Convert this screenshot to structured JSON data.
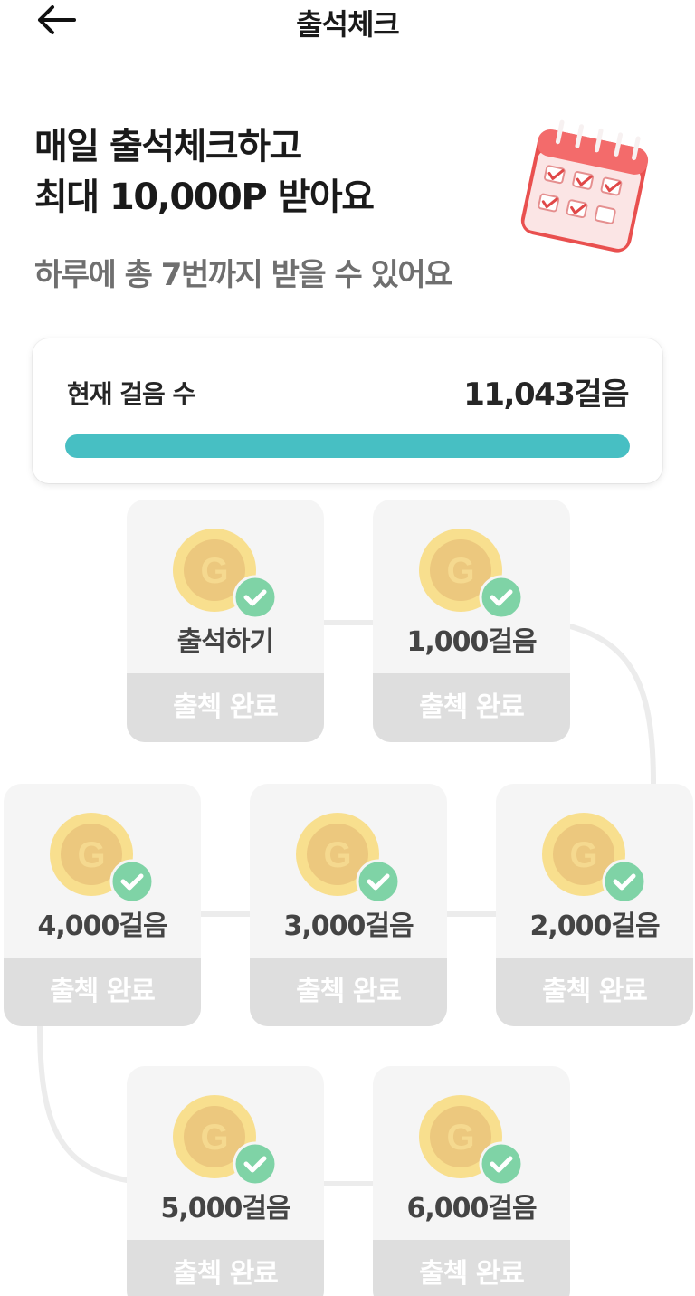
{
  "header": {
    "title": "출석체크"
  },
  "hero": {
    "title_line1": "매일 출석체크하고",
    "title_line2": "최대 10,000P 받아요",
    "subtitle": "하루에 총 7번까지 받을 수 있어요"
  },
  "steps": {
    "label": "현재 걸음 수",
    "value": "11,043걸음",
    "progress_fraction": 1.0
  },
  "rewards": [
    {
      "label": "출석하기",
      "status": "출첵 완료",
      "checked": true
    },
    {
      "label": "1,000걸음",
      "status": "출첵 완료",
      "checked": true
    },
    {
      "label": "2,000걸음",
      "status": "출첵 완료",
      "checked": true
    },
    {
      "label": "3,000걸음",
      "status": "출첵 완료",
      "checked": true
    },
    {
      "label": "4,000걸음",
      "status": "출첵 완료",
      "checked": true
    },
    {
      "label": "5,000걸음",
      "status": "출첵 완료",
      "checked": true
    },
    {
      "label": "6,000걸음",
      "status": "출첵 완료",
      "checked": true
    }
  ],
  "colors": {
    "accent": "#47bfc3",
    "check_badge": "#7fd3a6",
    "coin_outer": "#f8df8e",
    "coin_inner": "#ecc87e",
    "status_bg": "#dedede",
    "calendar_red": "#f36b6b"
  },
  "icons": {
    "back": "arrow-left-icon",
    "coin": "g-coin-icon",
    "check": "check-circle-icon",
    "calendar": "calendar-checklist-icon"
  }
}
